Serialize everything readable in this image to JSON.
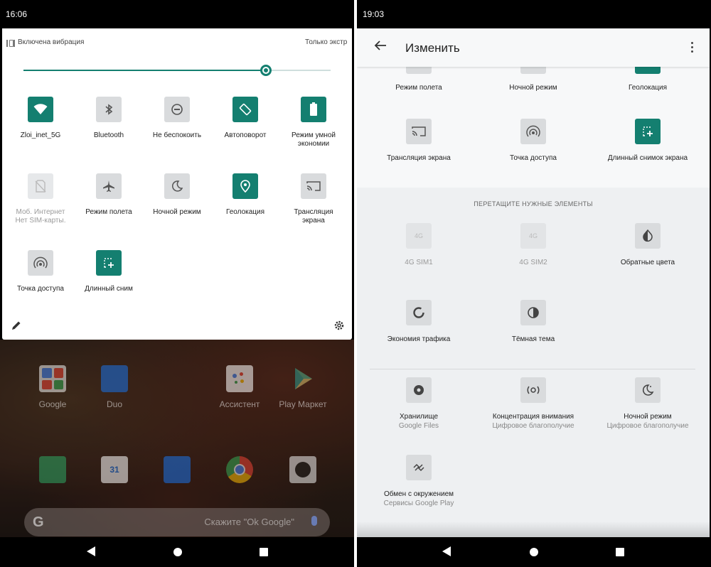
{
  "left": {
    "status_time": "16:06",
    "quick_settings": {
      "vibration_label": "Включена вибрация",
      "only_alarms_label": "Только экстр",
      "brightness_level": 0.79,
      "tiles": [
        {
          "label": "Zloi_inet_5G",
          "sub": "",
          "icon": "wifi-icon",
          "active": true
        },
        {
          "label": "Bluetooth",
          "sub": "",
          "icon": "bluetooth-icon",
          "active": false
        },
        {
          "label": "Не беспокоить",
          "sub": "",
          "icon": "dnd-icon",
          "active": false
        },
        {
          "label": "Автоповорот",
          "sub": "",
          "icon": "autorotate-icon",
          "active": true
        },
        {
          "label": "Режим умной",
          "sub": "экономии",
          "icon": "battery-saver-icon",
          "active": true
        },
        {
          "label": "Моб. Интернет",
          "sub": "Нет SIM-карты.",
          "icon": "no-sim-icon",
          "active": false,
          "disabled": true
        },
        {
          "label": "Режим полета",
          "sub": "",
          "icon": "airplane-icon",
          "active": false
        },
        {
          "label": "Ночной режим",
          "sub": "",
          "icon": "night-mode-icon",
          "active": false
        },
        {
          "label": "Геолокация",
          "sub": "",
          "icon": "location-icon",
          "active": true
        },
        {
          "label": "Трансляция",
          "sub": "экрана",
          "icon": "cast-icon",
          "active": false
        },
        {
          "label": "Точка доступа",
          "sub": "",
          "icon": "hotspot-icon",
          "active": false
        },
        {
          "label": "Длинный сним",
          "sub": "",
          "icon": "long-screenshot-icon",
          "active": true
        }
      ]
    },
    "apps": [
      {
        "label": "Google",
        "icon": "google-folder-icon"
      },
      {
        "label": "Duo",
        "icon": "duo-icon"
      },
      {
        "label": "Ассистент",
        "icon": "assistant-icon"
      },
      {
        "label": "Play Маркет",
        "icon": "play-store-icon"
      }
    ],
    "dock": [
      "phone-icon",
      "calendar-icon",
      "messages-icon",
      "chrome-icon",
      "camera-icon"
    ],
    "calendar_day": "31",
    "search_hint": "Скажите \"Ok Google\"",
    "search_logo": "G"
  },
  "right": {
    "status_time": "19:03",
    "title": "Изменить",
    "active_tiles": [
      {
        "label": "Режим полета",
        "icon": "airplane-icon"
      },
      {
        "label": "Ночной режим",
        "icon": "night-mode-icon"
      },
      {
        "label": "Геолокация",
        "icon": "location-icon"
      },
      {
        "label": "Трансляция экрана",
        "icon": "cast-icon"
      },
      {
        "label": "Точка доступа",
        "icon": "hotspot-icon"
      },
      {
        "label": "Длинный снимок экрана",
        "icon": "long-screenshot-icon",
        "active": true
      }
    ],
    "section_label": "ПЕРЕТАЩИТЕ НУЖНЫЕ ЭЛЕМЕНТЫ",
    "available_tiles": [
      {
        "label": "4G SIM1",
        "sub": "",
        "icon": "4g-icon",
        "disabled": true
      },
      {
        "label": "4G SIM2",
        "sub": "",
        "icon": "4g-icon",
        "disabled": true
      },
      {
        "label": "Обратные цвета",
        "sub": "",
        "icon": "invert-colors-icon"
      },
      {
        "label": "Экономия трафика",
        "sub": "",
        "icon": "data-saver-icon"
      },
      {
        "label": "Тёмная тема",
        "sub": "",
        "icon": "dark-theme-icon"
      }
    ],
    "third_party_tiles": [
      {
        "label": "Хранилище",
        "sub": "Google Files",
        "icon": "storage-icon"
      },
      {
        "label": "Концентрация внимания",
        "sub": "Цифровое благополучие",
        "icon": "focus-mode-icon"
      },
      {
        "label": "Ночной режим",
        "sub": "Цифровое благополучие",
        "icon": "bedtime-icon"
      },
      {
        "label": "Обмен с окружением",
        "sub": "Сервисы Google Play",
        "icon": "nearby-share-icon"
      }
    ]
  }
}
